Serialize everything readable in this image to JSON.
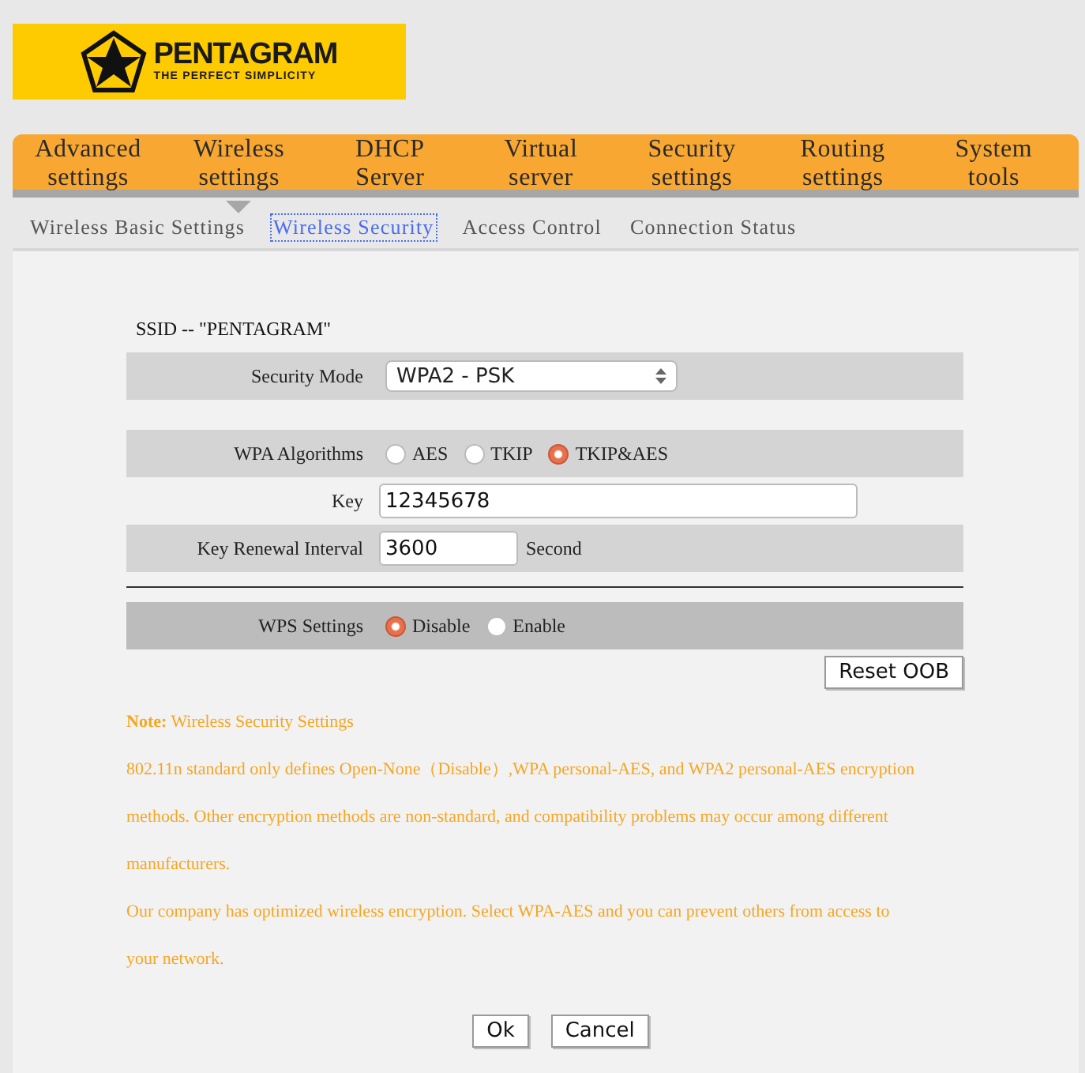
{
  "logo": {
    "name": "PENTAGRAM",
    "tagline": "THE PERFECT SIMPLICITY"
  },
  "nav": [
    {
      "label": "Advanced settings",
      "selected": false
    },
    {
      "label": "Wireless settings",
      "selected": true
    },
    {
      "label": "DHCP Server",
      "selected": false
    },
    {
      "label": "Virtual server",
      "selected": false
    },
    {
      "label": "Security settings",
      "selected": false
    },
    {
      "label": "Routing settings",
      "selected": false
    },
    {
      "label": "System tools",
      "selected": false
    }
  ],
  "subtabs": [
    {
      "label": "Wireless Basic Settings",
      "selected": false
    },
    {
      "label": "Wireless Security",
      "selected": true
    },
    {
      "label": "Access Control",
      "selected": false
    },
    {
      "label": "Connection Status",
      "selected": false
    }
  ],
  "ssid": "SSID -- \"PENTAGRAM\"",
  "rows": [
    {
      "kind": "select",
      "label": "Security Mode",
      "shaded": true,
      "dark": false,
      "value": "WPA2 - PSK"
    },
    {
      "kind": "spacer"
    },
    {
      "kind": "radios",
      "label": "WPA Algorithms",
      "shaded": true,
      "dark": false,
      "options": [
        {
          "label": "AES",
          "selected": false
        },
        {
          "label": "TKIP",
          "selected": false
        },
        {
          "label": "TKIP&AES",
          "selected": true
        }
      ]
    },
    {
      "kind": "input",
      "label": "Key",
      "shaded": false,
      "value": "12345678",
      "wide": true
    },
    {
      "kind": "input",
      "label": "Key Renewal Interval",
      "shaded": true,
      "dark": false,
      "value": "3600",
      "wide": false,
      "unit": "Second"
    },
    {
      "kind": "rule"
    },
    {
      "kind": "radios",
      "label": "WPS Settings",
      "shaded": true,
      "dark": true,
      "options": [
        {
          "label": "Disable",
          "selected": true
        },
        {
          "label": "Enable",
          "selected": false
        }
      ]
    }
  ],
  "reset_button": "Reset OOB",
  "note": [
    "**Note:** Wireless Security Settings",
    "802.11n standard only defines Open-None（Disable）,WPA personal-AES, and WPA2 personal-AES encryption methods. Other encryption methods are non-standard, and compatibility problems may occur among different manufacturers.",
    "Our company has optimized wireless encryption. Select WPA-AES and you can prevent others from access to your network."
  ],
  "buttons": [
    "Ok",
    "Cancel"
  ]
}
